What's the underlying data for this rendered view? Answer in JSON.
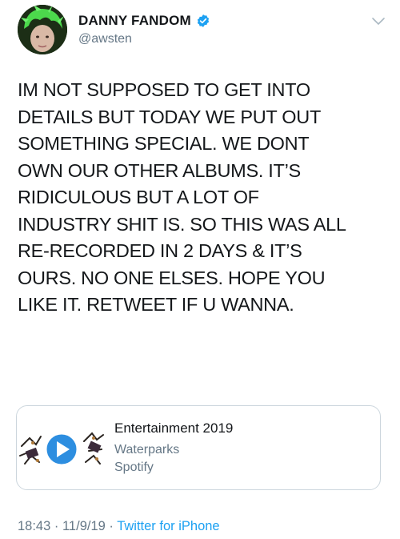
{
  "user": {
    "display_name": "DANNY FANDOM",
    "handle": "@awsten",
    "verified": true
  },
  "tweet": {
    "text": "IM NOT SUPPOSED TO GET INTO\nDETAILS BUT TODAY WE PUT OUT\nSOMETHING SPECIAL. WE DONT\nOWN OUR OTHER ALBUMS. IT’S\nRIDICULOUS BUT A LOT OF\nINDUSTRY SHIT IS. SO THIS WAS ALL\nRE-RECORDED IN 2 DAYS & IT’S\nOURS. NO ONE ELSES. HOPE YOU\nLIKE IT. RETWEET IF U WANNA."
  },
  "card": {
    "title": "Entertainment 2019",
    "artist": "Waterparks",
    "source": "Spotify"
  },
  "meta": {
    "time": "18:43",
    "separator": "·",
    "date": "11/9/19",
    "client": "Twitter for iPhone"
  },
  "colors": {
    "accent": "#1da1f2",
    "secondary_text": "#657786",
    "avatar_hair": "#4cd94c"
  },
  "icons": {
    "verified": "verified-badge-icon",
    "caret": "chevron-down-icon",
    "play": "play-icon"
  }
}
